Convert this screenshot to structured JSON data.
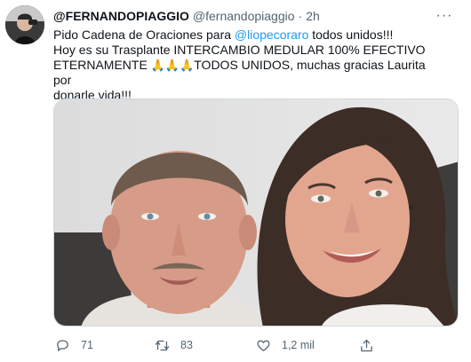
{
  "tweet": {
    "display_name": "@FERNANDOPIAGGIO",
    "handle": "@fernandopiaggio",
    "separator": "·",
    "time": "2h",
    "more": "···",
    "text_line1_pre": "Pido Cadena de Oraciones para ",
    "mention": "@liopecoraro",
    "text_line1_post": " todos unidos!!!",
    "text_line2": "Hoy es su Trasplante INTERCAMBIO MEDULAR 100% EFECTIVO",
    "text_line3_pre": "ETERNAMENTE ",
    "emojis": "🙏🙏🙏",
    "text_line3_post": "TODOS UNIDOS, muchas gracias Laurita por",
    "text_line4": "donarle vida!!!"
  },
  "actions": {
    "reply_count": "71",
    "retweet_count": "83",
    "like_count": "1,2 mil"
  },
  "colors": {
    "link": "#1d9bf0",
    "secondary_text": "#536471",
    "primary_text": "#0f1419",
    "border": "#cfd9de"
  },
  "icons": [
    "reply-icon",
    "retweet-icon",
    "like-icon",
    "share-icon",
    "more-icon"
  ]
}
